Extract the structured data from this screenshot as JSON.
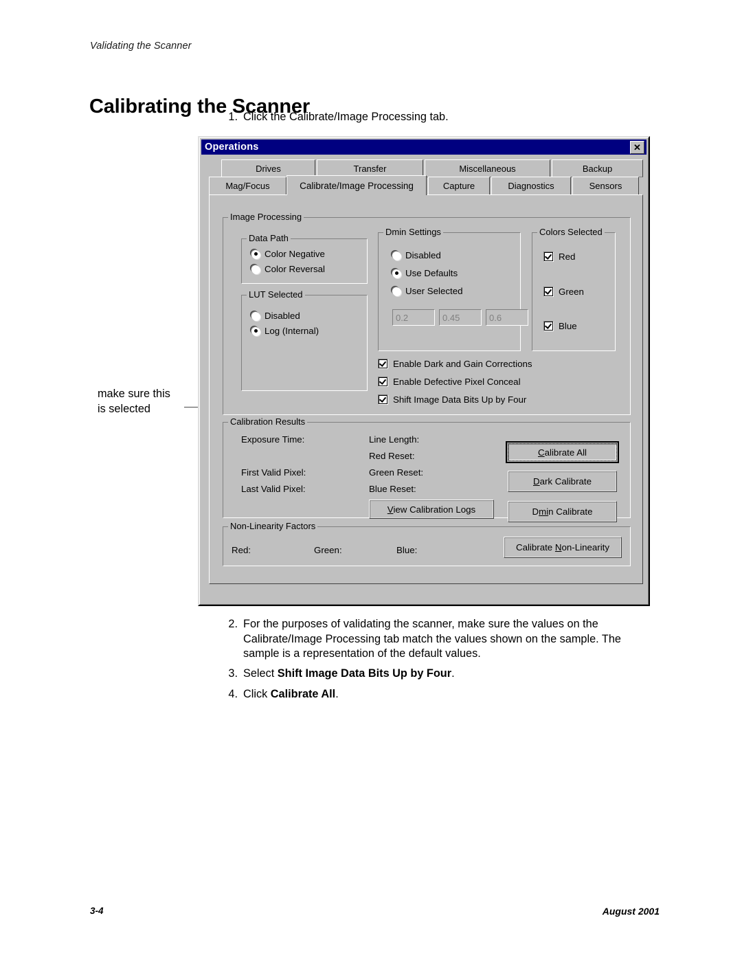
{
  "page": {
    "running_head": "Validating the Scanner",
    "title": "Calibrating the Scanner",
    "footer_left": "3-4",
    "footer_right": "August 2001"
  },
  "steps": [
    {
      "num": "1.",
      "text": "Click the Calibrate/Image Processing tab."
    },
    {
      "num": "2.",
      "text": "For the purposes of validating the scanner, make sure the values on the Calibrate/Image Processing tab match the values shown on the sample. The sample is a representation of the default values."
    },
    {
      "num": "3.",
      "text_pre": "Select ",
      "text_bold": "Shift Image Data Bits Up by Four",
      "text_post": "."
    },
    {
      "num": "4.",
      "text_pre": "Click ",
      "text_bold": "Calibrate All",
      "text_post": "."
    }
  ],
  "callout": {
    "line1": "make sure this",
    "line2": "is selected"
  },
  "dialog": {
    "title": "Operations",
    "close_label": "✕",
    "tabs_row1": [
      {
        "label": "Drives",
        "active": false
      },
      {
        "label": "Transfer",
        "active": false
      },
      {
        "label": "Miscellaneous",
        "active": false
      },
      {
        "label": "Backup",
        "active": false
      }
    ],
    "tabs_row2": [
      {
        "label": "Mag/Focus",
        "active": false
      },
      {
        "label": "Calibrate/Image Processing",
        "active": true
      },
      {
        "label": "Capture",
        "active": false
      },
      {
        "label": "Diagnostics",
        "active": false
      },
      {
        "label": "Sensors",
        "active": false
      }
    ],
    "image_processing": {
      "label": "Image Processing",
      "data_path": {
        "label": "Data Path",
        "options": [
          {
            "label": "Color Negative",
            "selected": true
          },
          {
            "label": "Color Reversal",
            "selected": false
          }
        ]
      },
      "lut_selected": {
        "label": "LUT Selected",
        "options": [
          {
            "label": "Disabled",
            "selected": false
          },
          {
            "label": "Log (Internal)",
            "selected": true
          }
        ]
      },
      "dmin_settings": {
        "label": "Dmin Settings",
        "options": [
          {
            "label": "Disabled",
            "selected": false
          },
          {
            "label": "Use Defaults",
            "selected": true
          },
          {
            "label": "User Selected",
            "selected": false
          }
        ],
        "values": [
          "0.2",
          "0.45",
          "0.6"
        ],
        "values_disabled": true
      },
      "colors_selected": {
        "label": "Colors Selected",
        "options": [
          {
            "label": "Red",
            "checked": true
          },
          {
            "label": "Green",
            "checked": true
          },
          {
            "label": "Blue",
            "checked": true
          }
        ]
      },
      "checkboxes": [
        {
          "label": "Enable Dark and Gain Corrections",
          "checked": true
        },
        {
          "label": "Enable Defective Pixel Conceal",
          "checked": true
        },
        {
          "label": "Shift Image Data Bits Up by Four",
          "checked": true
        }
      ]
    },
    "calibration_results": {
      "label": "Calibration Results",
      "col1": [
        "Exposure Time:",
        "First Valid Pixel:",
        "Last Valid Pixel:"
      ],
      "col2": [
        "Line Length:",
        "Red Reset:",
        "Green Reset:",
        "Blue Reset:"
      ],
      "view_logs_button": {
        "accel": "V",
        "rest": "iew Calibration Logs"
      },
      "buttons": [
        {
          "accel": "C",
          "rest": "alibrate All",
          "pre": "",
          "default": true
        },
        {
          "accel": "D",
          "rest": "ark Calibrate",
          "pre": "",
          "default": false
        },
        {
          "accel": "mi",
          "rest": "n Calibrate",
          "pre": "D",
          "default": false
        }
      ]
    },
    "non_linearity": {
      "label": "Non-Linearity Factors",
      "fields": [
        "Red:",
        "Green:",
        "Blue:"
      ],
      "button": {
        "pre": "Calibrate ",
        "accel": "N",
        "rest": "on-Linearity"
      }
    }
  }
}
